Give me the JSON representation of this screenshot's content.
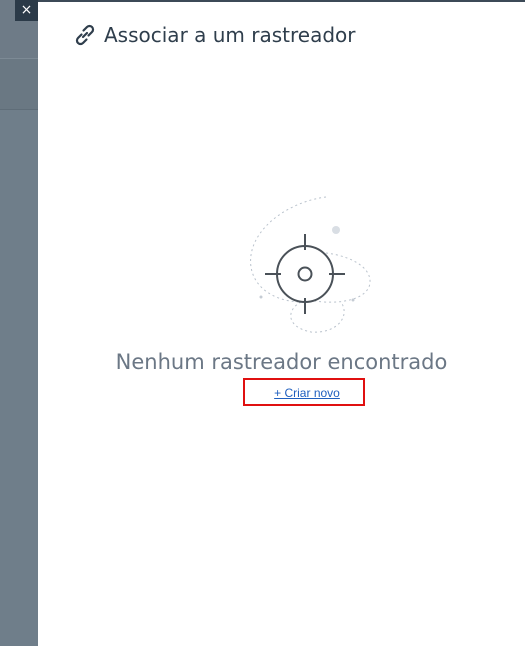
{
  "window": {
    "close_glyph": "×"
  },
  "panel": {
    "title": "Associar a um rastreador",
    "title_icon": "link-icon"
  },
  "empty_state": {
    "illustration_icon": "crosshair-icon",
    "message": "Nenhum rastreador encontrado",
    "create_link_label": "+ Criar novo"
  },
  "colors": {
    "highlight": "#e01010",
    "link": "#1f5fbf",
    "title": "#2f3e4c",
    "muted_text": "#6b7785"
  }
}
